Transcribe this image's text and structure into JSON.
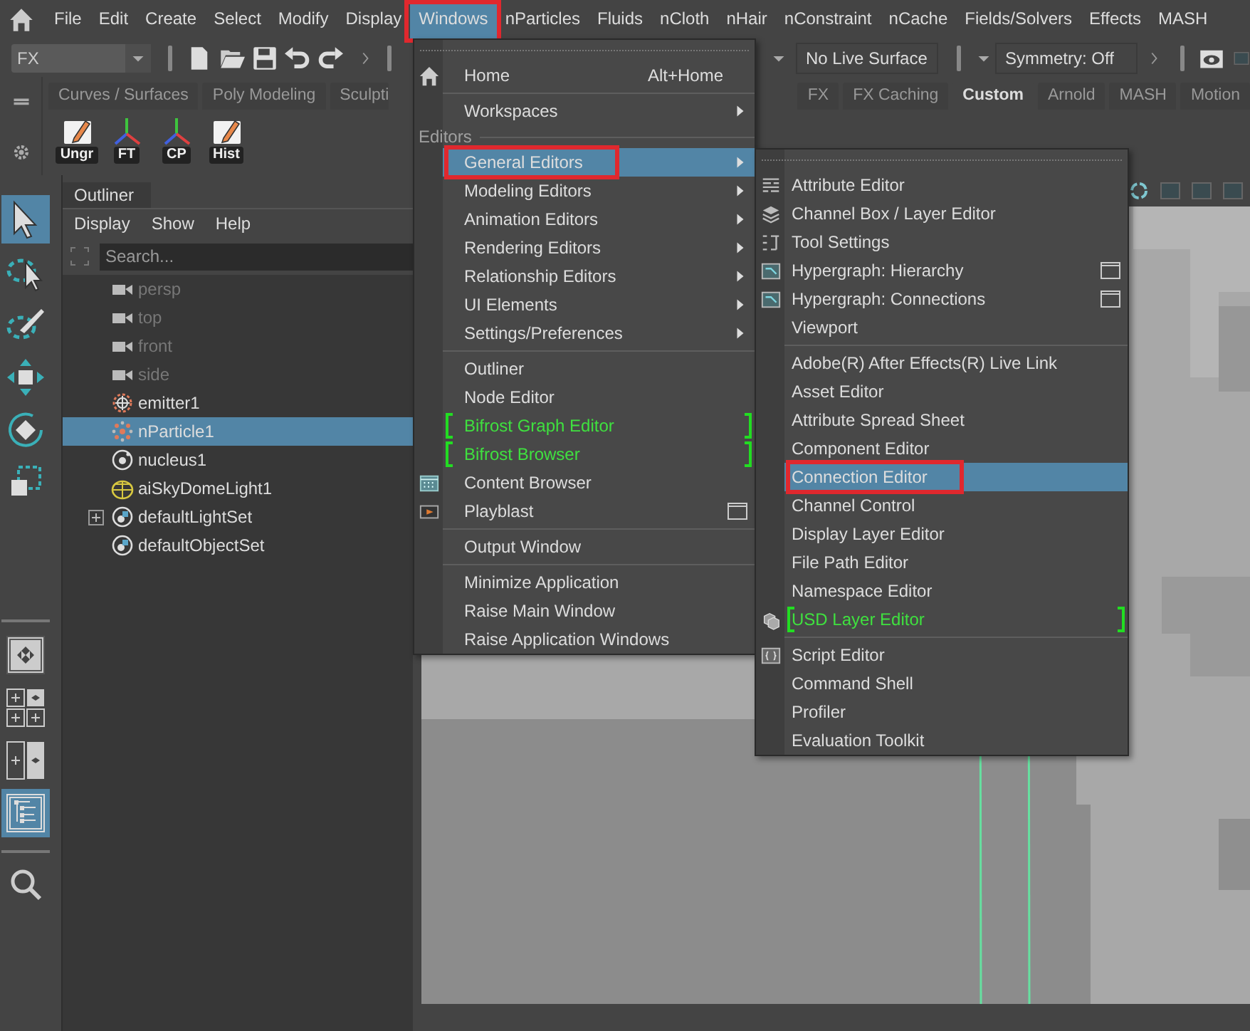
{
  "menubar": [
    {
      "label": "File",
      "selected": false
    },
    {
      "label": "Edit",
      "selected": false
    },
    {
      "label": "Create",
      "selected": false
    },
    {
      "label": "Select",
      "selected": false
    },
    {
      "label": "Modify",
      "selected": false
    },
    {
      "label": "Display",
      "selected": false
    },
    {
      "label": "Windows",
      "selected": true,
      "outlined": true
    },
    {
      "label": "nParticles",
      "selected": false
    },
    {
      "label": "Fluids",
      "selected": false
    },
    {
      "label": "nCloth",
      "selected": false
    },
    {
      "label": "nHair",
      "selected": false
    },
    {
      "label": "nConstraint",
      "selected": false
    },
    {
      "label": "nCache",
      "selected": false
    },
    {
      "label": "Fields/Solvers",
      "selected": false
    },
    {
      "label": "Effects",
      "selected": false
    },
    {
      "label": "MASH",
      "selected": false
    }
  ],
  "toolbar": {
    "menu_set": "FX",
    "live_surface": "No Live Surface",
    "symmetry": "Symmetry: Off"
  },
  "shelf": {
    "tab_groups": [
      [
        {
          "label": "Curves / Surfaces",
          "selected": false
        },
        {
          "label": "Poly Modeling",
          "selected": false
        },
        {
          "label": "Sculpti",
          "selected": false
        }
      ],
      [
        {
          "label": "FX",
          "selected": false
        },
        {
          "label": "FX Caching",
          "selected": false
        },
        {
          "label": "Custom",
          "selected": true
        },
        {
          "label": "Arnold",
          "selected": false
        },
        {
          "label": "MASH",
          "selected": false
        },
        {
          "label": "Motion",
          "selected": false
        }
      ]
    ],
    "buttons": [
      {
        "label": "Ungr",
        "kind": "note"
      },
      {
        "label": "FT",
        "kind": "axes"
      },
      {
        "label": "CP",
        "kind": "axes"
      },
      {
        "label": "Hist",
        "kind": "note"
      }
    ]
  },
  "outliner": {
    "title": "Outliner",
    "menu": [
      "Display",
      "Show",
      "Help"
    ],
    "search": {
      "placeholder": "Search..."
    },
    "items": [
      {
        "label": "persp",
        "kind": "camera",
        "dimmed": true,
        "selected": false,
        "expandable": false
      },
      {
        "label": "top",
        "kind": "camera",
        "dimmed": true,
        "selected": false,
        "expandable": false
      },
      {
        "label": "front",
        "kind": "camera",
        "dimmed": true,
        "selected": false,
        "expandable": false
      },
      {
        "label": "side",
        "kind": "camera",
        "dimmed": true,
        "selected": false,
        "expandable": false
      },
      {
        "label": "emitter1",
        "kind": "emitter",
        "dimmed": false,
        "selected": false,
        "expandable": false
      },
      {
        "label": "nParticle1",
        "kind": "particles",
        "dimmed": false,
        "selected": true,
        "expandable": false
      },
      {
        "label": "nucleus1",
        "kind": "nucleus",
        "dimmed": false,
        "selected": false,
        "expandable": false
      },
      {
        "label": "aiSkyDomeLight1",
        "kind": "light",
        "dimmed": false,
        "selected": false,
        "expandable": false
      },
      {
        "label": "defaultLightSet",
        "kind": "set",
        "dimmed": false,
        "selected": false,
        "expandable": true
      },
      {
        "label": "defaultObjectSet",
        "kind": "set",
        "dimmed": false,
        "selected": false,
        "expandable": false
      }
    ]
  },
  "windows_menu": {
    "items": [
      {
        "kind": "item",
        "label": "Home",
        "shortcut": "Alt+Home",
        "selected": false
      },
      {
        "kind": "separator"
      },
      {
        "kind": "submenu",
        "label": "Workspaces",
        "selected": false
      },
      {
        "kind": "section",
        "label": "Editors"
      },
      {
        "kind": "submenu",
        "label": "General Editors",
        "selected": true,
        "outlined": true
      },
      {
        "kind": "submenu",
        "label": "Modeling Editors",
        "selected": false
      },
      {
        "kind": "submenu",
        "label": "Animation Editors",
        "selected": false
      },
      {
        "kind": "submenu",
        "label": "Rendering Editors",
        "selected": false
      },
      {
        "kind": "submenu",
        "label": "Relationship Editors",
        "selected": false
      },
      {
        "kind": "submenu",
        "label": "UI Elements",
        "selected": false
      },
      {
        "kind": "submenu",
        "label": "Settings/Preferences",
        "selected": false
      },
      {
        "kind": "separator"
      },
      {
        "kind": "item",
        "label": "Outliner",
        "selected": false
      },
      {
        "kind": "item",
        "label": "Node Editor",
        "selected": false
      },
      {
        "kind": "plugin",
        "label": "Bifrost Graph Editor",
        "selected": false
      },
      {
        "kind": "plugin",
        "label": "Bifrost Browser",
        "selected": false
      },
      {
        "kind": "item",
        "label": "Content Browser",
        "selected": false
      },
      {
        "kind": "item",
        "label": "Playblast",
        "option_box": true,
        "selected": false
      },
      {
        "kind": "separator"
      },
      {
        "kind": "item",
        "label": "Output Window",
        "selected": false
      },
      {
        "kind": "separator"
      },
      {
        "kind": "item",
        "label": "Minimize Application",
        "selected": false
      },
      {
        "kind": "item",
        "label": "Raise Main Window",
        "selected": false
      },
      {
        "kind": "item",
        "label": "Raise Application Windows",
        "selected": false
      }
    ]
  },
  "general_editors_menu": {
    "items": [
      {
        "kind": "item",
        "label": "Attribute Editor",
        "selected": false
      },
      {
        "kind": "item",
        "label": "Channel Box / Layer Editor",
        "selected": false
      },
      {
        "kind": "item",
        "label": "Tool Settings",
        "selected": false
      },
      {
        "kind": "item",
        "label": "Hypergraph: Hierarchy",
        "option_box": true,
        "selected": false
      },
      {
        "kind": "item",
        "label": "Hypergraph: Connections",
        "option_box": true,
        "selected": false
      },
      {
        "kind": "item",
        "label": "Viewport",
        "selected": false
      },
      {
        "kind": "separator"
      },
      {
        "kind": "item",
        "label": "Adobe(R) After Effects(R) Live Link",
        "selected": false
      },
      {
        "kind": "item",
        "label": "Asset Editor",
        "selected": false
      },
      {
        "kind": "item",
        "label": "Attribute Spread Sheet",
        "selected": false
      },
      {
        "kind": "item",
        "label": "Component Editor",
        "selected": false
      },
      {
        "kind": "item",
        "label": "Connection Editor",
        "selected": true,
        "outlined": true
      },
      {
        "kind": "item",
        "label": "Channel Control",
        "selected": false
      },
      {
        "kind": "item",
        "label": "Display Layer Editor",
        "selected": false
      },
      {
        "kind": "item",
        "label": "File Path Editor",
        "selected": false
      },
      {
        "kind": "item",
        "label": "Namespace Editor",
        "selected": false
      },
      {
        "kind": "plugin",
        "label": "USD Layer Editor",
        "selected": false
      },
      {
        "kind": "separator"
      },
      {
        "kind": "item",
        "label": "Script Editor",
        "selected": false
      },
      {
        "kind": "item",
        "label": "Command Shell",
        "selected": false
      },
      {
        "kind": "item",
        "label": "Profiler",
        "selected": false
      },
      {
        "kind": "item",
        "label": "Evaluation Toolkit",
        "selected": false
      }
    ]
  }
}
